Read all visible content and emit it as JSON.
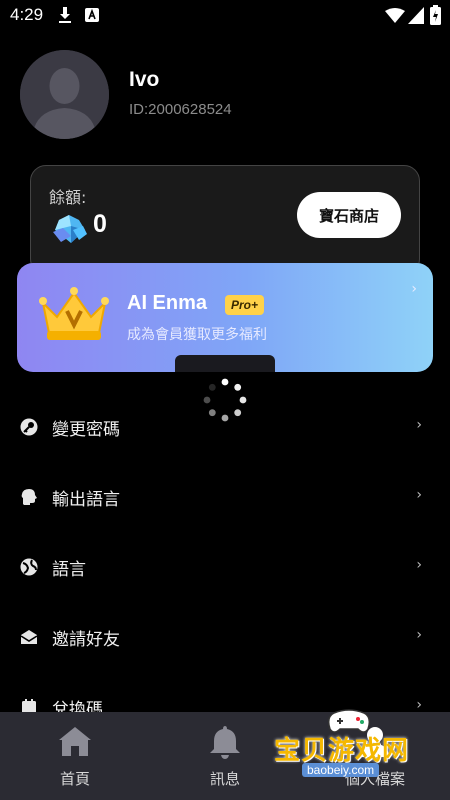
{
  "status_bar": {
    "time": "4:29",
    "icons": [
      "download-icon",
      "notification-app-icon",
      "wifi-icon",
      "signal-icon",
      "battery-icon"
    ]
  },
  "profile": {
    "name": "Ivo",
    "id_text": "ID:2000628524"
  },
  "balance": {
    "label": "餘額:",
    "value": "0",
    "shop_button": "寶石商店"
  },
  "vip": {
    "title": "AI Enma",
    "badge": "Pro+",
    "subtitle": "成為會員獲取更多福利",
    "chevron": "›"
  },
  "menu": {
    "items": [
      {
        "label": "變更密碼",
        "icon": "key-icon"
      },
      {
        "label": "輸出語言",
        "icon": "speaking-head-icon"
      },
      {
        "label": "語言",
        "icon": "globe-icon"
      },
      {
        "label": "邀請好友",
        "icon": "mail-icon"
      },
      {
        "label": "兌換碼",
        "icon": "coupon-icon"
      }
    ],
    "chevron": "›"
  },
  "bottom_nav": {
    "items": [
      {
        "label": "首頁",
        "icon": "home-icon"
      },
      {
        "label": "訊息",
        "icon": "bell-icon"
      },
      {
        "label": "個人檔案",
        "icon": "profile-icon"
      }
    ]
  },
  "watermark": {
    "title": "宝贝游戏网",
    "url": "baobeiy.com"
  },
  "colors": {
    "background": "#000000",
    "card": "#1a1a1a",
    "vip_gradient_start": "#8f86f2",
    "vip_gradient_end": "#8fd2f8",
    "badge": "#ffd24a",
    "nav_bg": "#2b2b33"
  }
}
